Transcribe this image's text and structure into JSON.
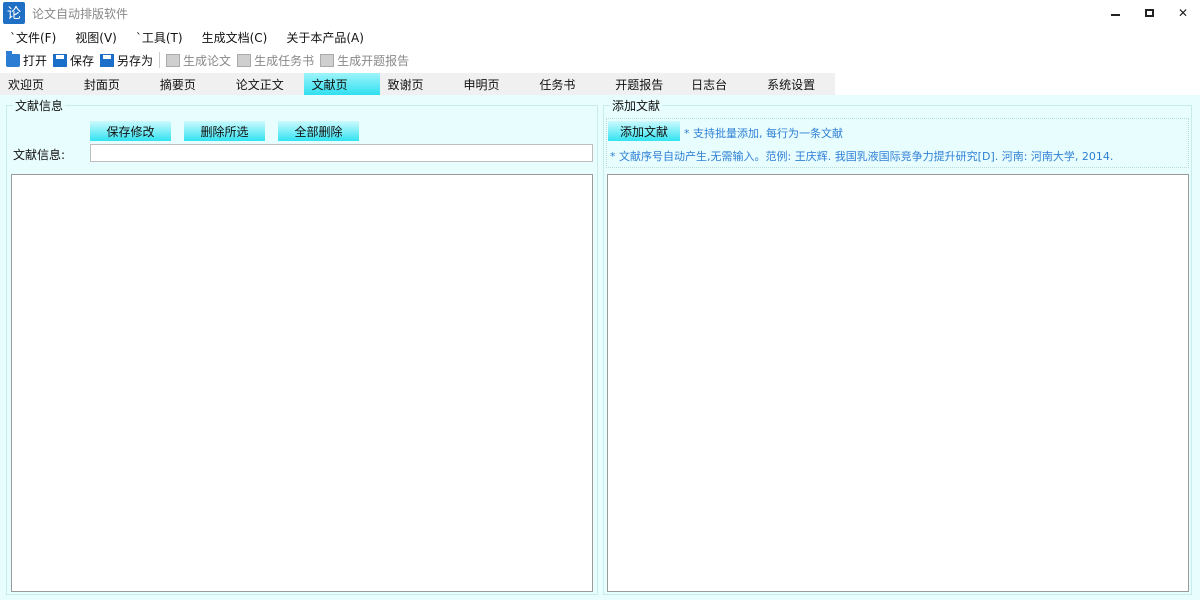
{
  "window": {
    "icon_glyph": "论",
    "title": "论文自动排版软件"
  },
  "menu": [
    "`文件(F)",
    "视图(V)",
    "`工具(T)",
    "生成文档(C)",
    "关于本产品(A)"
  ],
  "toolbar": {
    "open": "打开",
    "save": "保存",
    "save_as": "另存为",
    "gen_thesis": "生成论文",
    "gen_task": "生成任务书",
    "gen_proposal": "生成开题报告"
  },
  "tabs": [
    "欢迎页",
    "封面页",
    "摘要页",
    "论文正文",
    "文献页",
    "致谢页",
    "申明页",
    "任务书",
    "开题报告",
    "日志台",
    "系统设置"
  ],
  "active_tab": "文献页",
  "left_panel": {
    "title": "文献信息",
    "save_button": "保存修改",
    "delete_selected_button": "删除所选",
    "delete_all_button": "全部删除",
    "field_label": "文献信息:",
    "field_value": ""
  },
  "right_panel": {
    "title": "添加文献",
    "add_button": "添加文献",
    "hint_batch": "* 支持批量添加, 每行为一条文献",
    "hint_example": "* 文献序号自动产生,无需输入。范例: 王庆辉. 我国乳液国际竞争力提升研究[D]. 河南: 河南大学, 2014."
  },
  "colors": {
    "accent_cyan": "#32e3f2",
    "background": "#e8fdfd",
    "hint_blue": "#2f7fd6"
  }
}
